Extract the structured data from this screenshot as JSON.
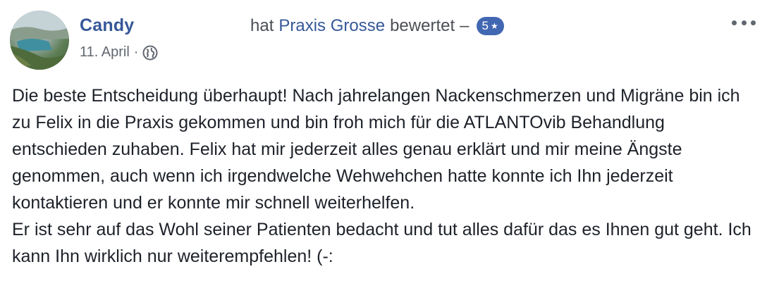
{
  "post": {
    "author": "Candy",
    "action_prefix": "hat",
    "page_name": "Praxis Grosse",
    "action_suffix": "bewertet",
    "dash": "–",
    "rating": "5",
    "rating_icon": "star-icon",
    "rating_star": "★",
    "date": "11. April",
    "date_separator": "·",
    "privacy_icon": "globe-icon",
    "menu_icon": "more-options-icon"
  },
  "review": {
    "paragraphs": [
      "Die beste Entscheidung überhaupt! Nach jahrelangen Nackenschmerzen und Migräne bin ich zu Felix in die Praxis gekommen und bin froh mich für die ATLANTOvib Behandlung entschieden zuhaben. Felix hat mir jederzeit alles genau erklärt und mir meine Ängste genommen, auch wenn ich irgendwelche Wehwehchen hatte konnte ich Ihn jederzeit kontaktieren und er konnte mir schnell weiterhelfen.",
      "Er ist sehr auf das Wohl seiner Patienten bedacht und tut alles dafür das es Ihnen gut geht. Ich kann Ihn wirklich nur weiterempfehlen! (-:"
    ]
  },
  "colors": {
    "link": "#365899",
    "text": "#1d2129",
    "meta": "#616770",
    "badge": "#4267b2"
  }
}
